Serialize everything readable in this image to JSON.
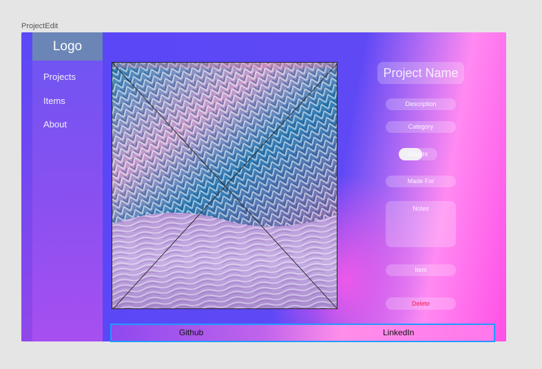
{
  "frame": {
    "label": "ProjectEdit"
  },
  "sidebar": {
    "logo": "Logo",
    "items": [
      {
        "label": "Projects"
      },
      {
        "label": "Items"
      },
      {
        "label": "About"
      }
    ]
  },
  "form": {
    "project_name": "Project Name",
    "description_placeholder": "Description",
    "category_placeholder": "Category",
    "bought_label": "Bought",
    "made_for_placeholder": "Made For",
    "notes_placeholder": "Notes",
    "item_placeholder": "Item",
    "delete_label": "Delete"
  },
  "footer": {
    "github": "Github",
    "linkedin": "LinkedIn"
  },
  "colors": {
    "frame_left": "#5946f6",
    "frame_right": "#ff4fe6",
    "logo_bg": "#6b86b6",
    "footer_border": "#1e9bff",
    "delete_text": "#ff1744"
  },
  "icons": {
    "image_placeholder": "image-placeholder-icon"
  }
}
